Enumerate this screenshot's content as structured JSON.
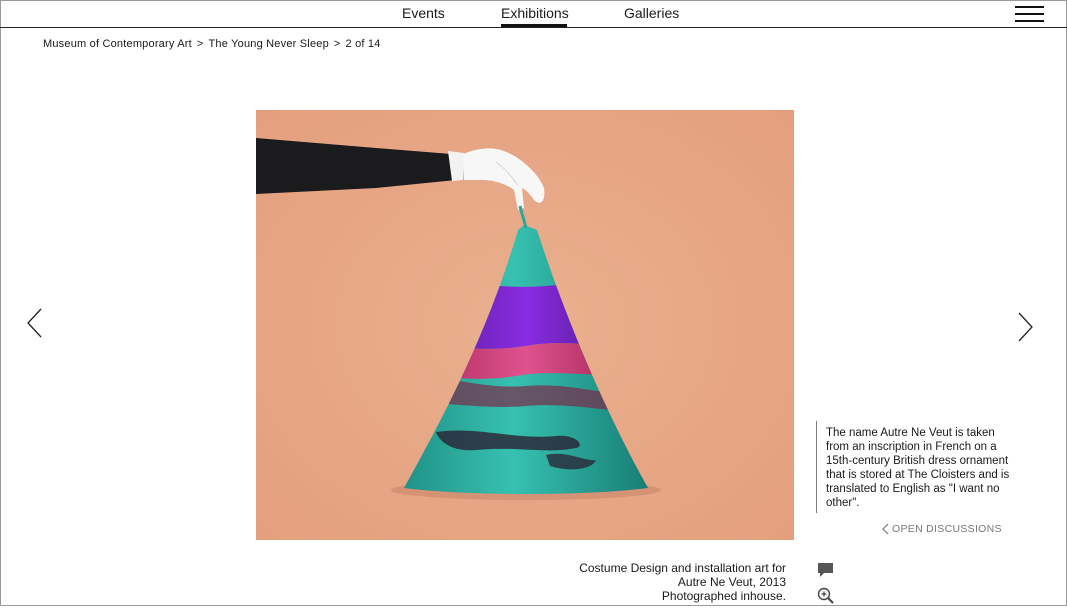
{
  "nav": {
    "items": [
      {
        "label": "Events"
      },
      {
        "label": "Exhibitions",
        "active": true
      },
      {
        "label": "Galleries"
      }
    ],
    "menu_icon": "hamburger-menu-icon"
  },
  "breadcrumb": {
    "museum": "Museum of Contemporary Art",
    "exhibition": "The Young Never Sleep",
    "position": "2 of 14",
    "separator": ">"
  },
  "artwork": {
    "background_color": "#e8a787"
  },
  "description": {
    "text": "The name Autre Ne Veut is taken from an inscription in French on a 15th-century British dress ornament that is stored at The Cloisters and is translated to English as \"I want no other\"."
  },
  "discussion": {
    "label": "OPEN DISCUSSIONS"
  },
  "caption": {
    "line1": "Costume Design and installation art for",
    "line2": "Autre Ne Veut, 2013",
    "line3": "Photographed inhouse."
  },
  "icons": {
    "prev": "chevron-left-icon",
    "next": "chevron-right-icon",
    "comment": "comment-icon",
    "zoom": "zoom-in-icon"
  }
}
